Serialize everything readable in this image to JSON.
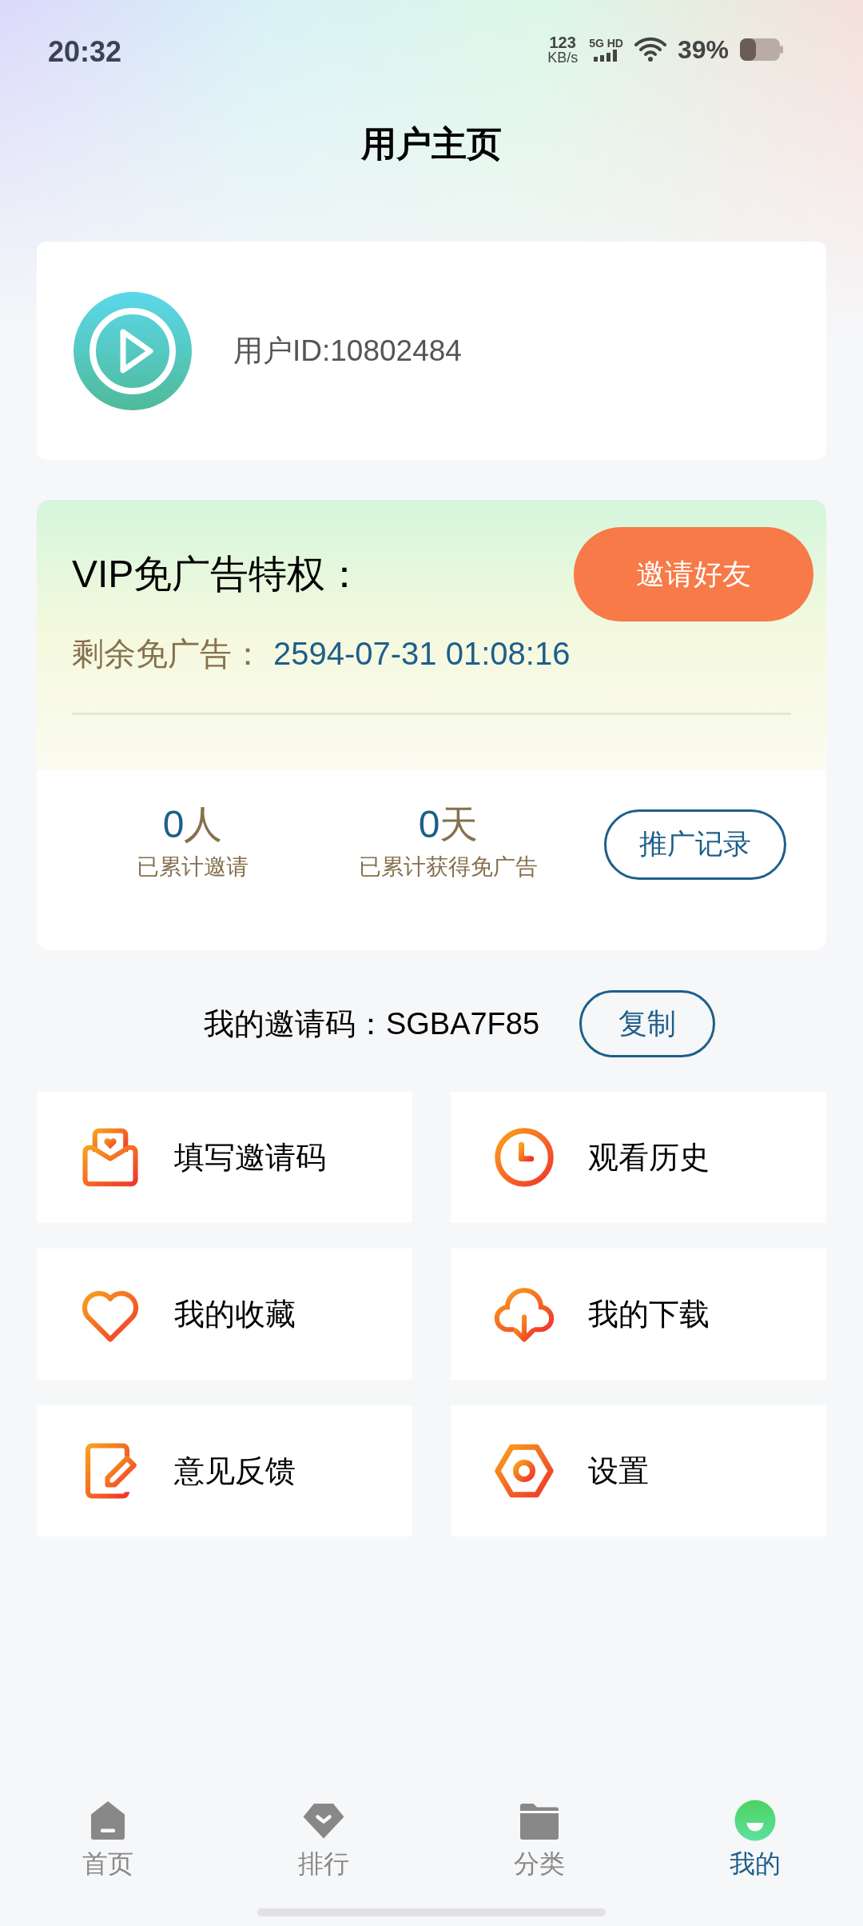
{
  "status_bar": {
    "time": "20:32",
    "net_speed": "123",
    "net_unit": "KB/s",
    "network": "5G HD",
    "battery": "39%"
  },
  "title": "用户主页",
  "profile": {
    "user_id": "用户ID:10802484"
  },
  "vip": {
    "title": "VIP免广告特权：",
    "invite_button": "邀请好友",
    "remaining_label": "剩余免广告：",
    "remaining_value": "2594-07-31 01:08:16",
    "records_button": "推广记录",
    "stats": [
      {
        "value": "0",
        "unit": "人",
        "label": "已累计邀请"
      },
      {
        "value": "0",
        "unit": "天",
        "label": "已累计获得免广告"
      }
    ]
  },
  "invite_code": {
    "label": "我的邀请码：SGBA7F85",
    "copy_button": "复制"
  },
  "menu": [
    {
      "kind": "envelope",
      "label": "填写邀请码"
    },
    {
      "kind": "clock",
      "label": "观看历史"
    },
    {
      "kind": "heart",
      "label": "我的收藏"
    },
    {
      "kind": "download",
      "label": "我的下载"
    },
    {
      "kind": "edit",
      "label": "意见反馈"
    },
    {
      "kind": "settings",
      "label": "设置"
    }
  ],
  "bottom_nav": [
    {
      "kind": "home",
      "label": "首页",
      "selected": false
    },
    {
      "kind": "rank",
      "label": "排行",
      "selected": false
    },
    {
      "kind": "category",
      "label": "分类",
      "selected": false
    },
    {
      "kind": "mine",
      "label": "我的",
      "selected": true
    }
  ]
}
